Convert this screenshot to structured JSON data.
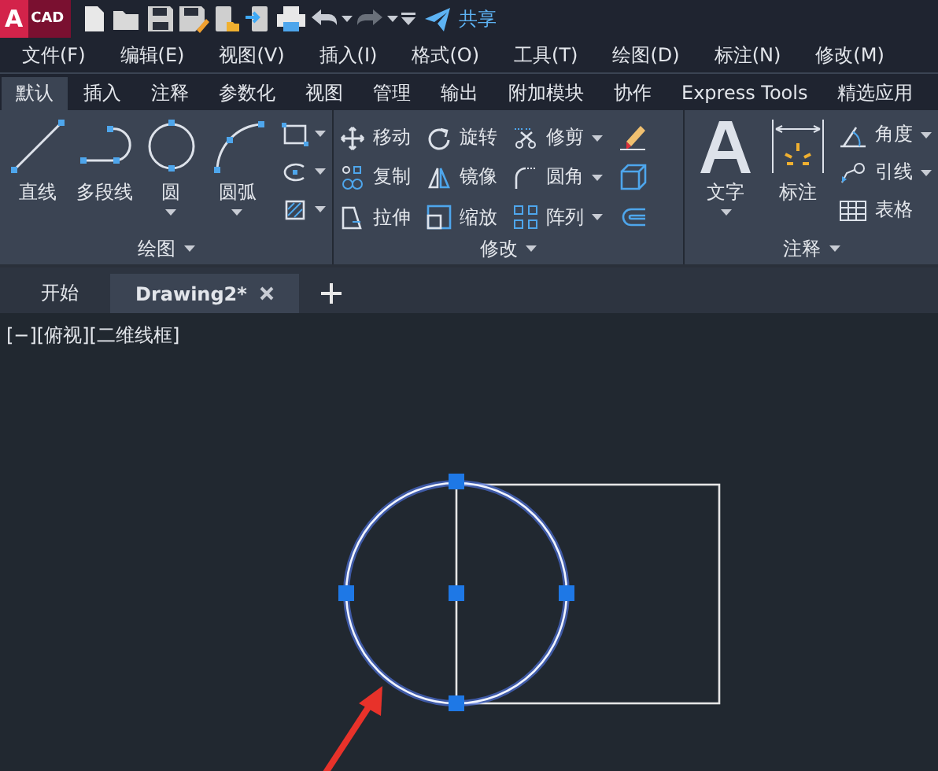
{
  "app_logo": {
    "letter": "A",
    "label": "CAD"
  },
  "share": {
    "label": "共享"
  },
  "menu": [
    "文件(F)",
    "编辑(E)",
    "视图(V)",
    "插入(I)",
    "格式(O)",
    "工具(T)",
    "绘图(D)",
    "标注(N)",
    "修改(M)"
  ],
  "ribbon_tabs": [
    {
      "label": "默认",
      "selected": true
    },
    {
      "label": "插入",
      "selected": false
    },
    {
      "label": "注释",
      "selected": false
    },
    {
      "label": "参数化",
      "selected": false
    },
    {
      "label": "视图",
      "selected": false
    },
    {
      "label": "管理",
      "selected": false
    },
    {
      "label": "输出",
      "selected": false
    },
    {
      "label": "附加模块",
      "selected": false
    },
    {
      "label": "协作",
      "selected": false
    },
    {
      "label": "Express Tools",
      "selected": false
    },
    {
      "label": "精选应用",
      "selected": false
    }
  ],
  "draw_panel": {
    "title": "绘图",
    "large_tools": [
      {
        "label": "直线",
        "dropdown": false
      },
      {
        "label": "多段线",
        "dropdown": false
      },
      {
        "label": "圆",
        "dropdown": true
      },
      {
        "label": "圆弧",
        "dropdown": true
      }
    ]
  },
  "modify_panel": {
    "title": "修改",
    "tools": [
      {
        "label": "移动",
        "dropdown": false
      },
      {
        "label": "旋转",
        "dropdown": false
      },
      {
        "label": "修剪",
        "dropdown": true
      },
      {
        "label": "复制",
        "dropdown": false
      },
      {
        "label": "镜像",
        "dropdown": false
      },
      {
        "label": "圆角",
        "dropdown": true
      },
      {
        "label": "拉伸",
        "dropdown": false
      },
      {
        "label": "缩放",
        "dropdown": false
      },
      {
        "label": "阵列",
        "dropdown": true
      }
    ]
  },
  "annotation_panel": {
    "title": "注释",
    "large_tools": [
      {
        "label": "文字",
        "dropdown": true
      },
      {
        "label": "标注",
        "dropdown": false
      }
    ],
    "small_tools": [
      {
        "label": "角度",
        "dropdown": true
      },
      {
        "label": "引线",
        "dropdown": true
      },
      {
        "label": "表格",
        "dropdown": false
      }
    ]
  },
  "document_tabs": [
    {
      "label": "开始",
      "selected": false
    },
    {
      "label": "Drawing2*",
      "selected": true
    }
  ],
  "viewport_label": "[−][俯视][二维线框]"
}
